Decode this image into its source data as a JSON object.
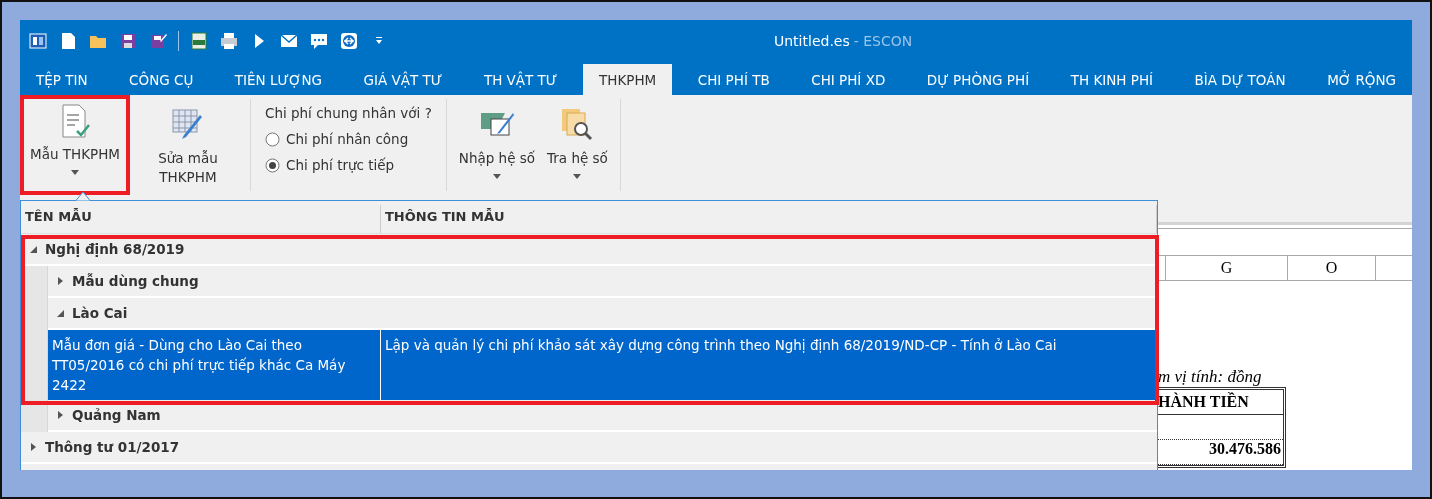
{
  "window": {
    "title": "Untitled.es",
    "app_name": "- ESCON"
  },
  "tabs": [
    {
      "label": "TỆP TIN",
      "selected": false
    },
    {
      "label": "CÔNG CỤ",
      "selected": false
    },
    {
      "label": "TIÊN LƯỢNG",
      "selected": false
    },
    {
      "label": "GIÁ VẬT TƯ",
      "selected": false
    },
    {
      "label": "TH VẬT TƯ",
      "selected": false
    },
    {
      "label": "THKPHM",
      "selected": true
    },
    {
      "label": "CHI PHÍ TB",
      "selected": false
    },
    {
      "label": "CHI PHÍ XD",
      "selected": false
    },
    {
      "label": "DỰ PHÒNG PHÍ",
      "selected": false
    },
    {
      "label": "TH KINH PHÍ",
      "selected": false
    },
    {
      "label": "BÌA DỰ TOÁN",
      "selected": false
    },
    {
      "label": "MỞ RỘNG",
      "selected": false
    }
  ],
  "ribbon": {
    "template_buttons": [
      {
        "kind": "template",
        "label": "Mẫu THKPHM",
        "dropdown": true,
        "highlighted": true
      },
      {
        "kind": "edit-grid",
        "label": "Sửa mẫu THKPHM",
        "dropdown": false,
        "highlighted": false
      }
    ],
    "radio_group": {
      "label": "Chi phí chung nhân với ?",
      "options": [
        {
          "label": "Chi phí nhân công",
          "selected": false
        },
        {
          "label": "Chi phí trực tiếp",
          "selected": true
        }
      ]
    },
    "coefficient_buttons": [
      {
        "kind": "import",
        "label": "Nhập hệ số",
        "dropdown": true,
        "highlighted": false
      },
      {
        "kind": "lookup",
        "label": "Tra hệ số",
        "dropdown": true,
        "highlighted": false
      }
    ]
  },
  "template_picker": {
    "columns": [
      "TÊN MẪU",
      "THÔNG TIN MẪU"
    ],
    "highlighted": true,
    "tree": [
      {
        "name": "Nghị định 68/2019",
        "expanded": true,
        "children": [
          {
            "name": "Mẫu dùng chung",
            "expanded": false
          },
          {
            "name": "Lào Cai",
            "expanded": true,
            "children": [
              {
                "name": "Mẫu đơn giá - Dùng cho Lào Cai theo TT05/2016 có chi phí trực tiếp khác Ca Máy 2422",
                "info": "Lập và quản lý chi phí khảo sát xây dựng công trình theo Nghị định 68/2019/ND-CP - Tính ở Lào Cai",
                "selected": true
              }
            ]
          },
          {
            "name": "Quảng Nam",
            "expanded": false
          }
        ]
      },
      {
        "name": "Thông tư 01/2017",
        "expanded": false
      }
    ]
  },
  "spreadsheet": {
    "columns": [
      "G",
      "O"
    ],
    "unit_note": "m vị tính: đồng",
    "table_header": "HÀNH TIỀN",
    "values": [
      "30.476.586"
    ]
  }
}
